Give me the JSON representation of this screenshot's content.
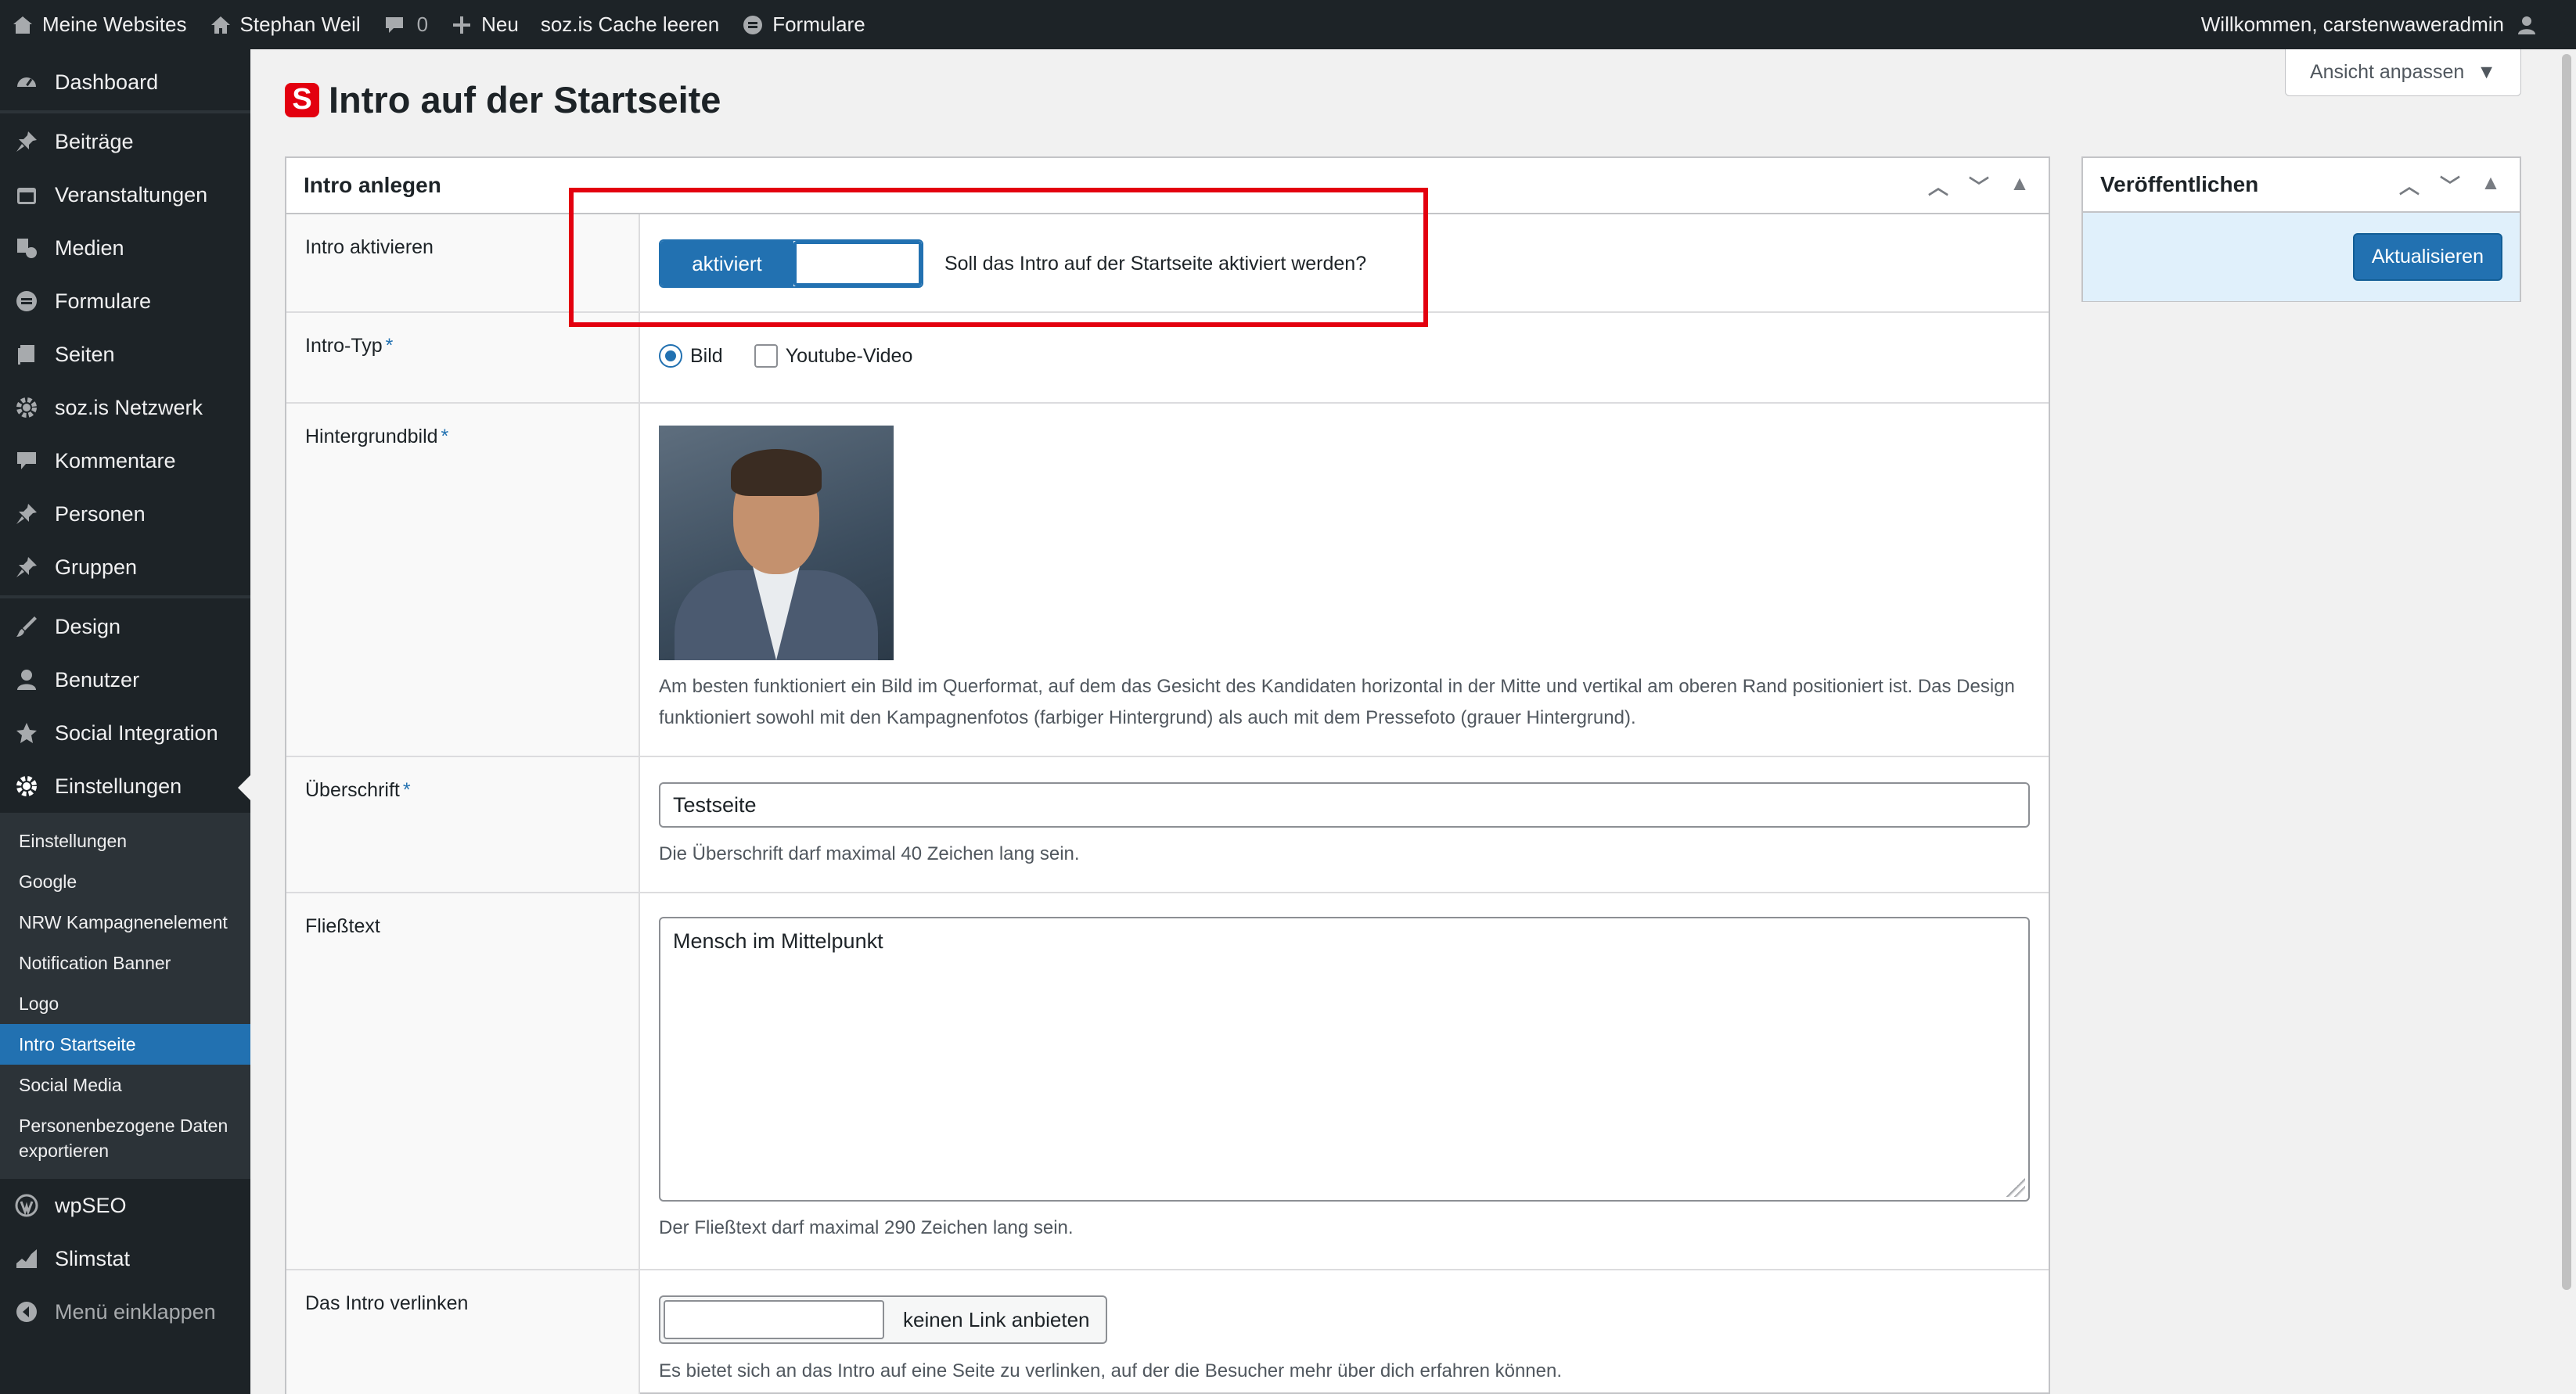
{
  "adminbar": {
    "my_sites": "Meine Websites",
    "site_name": "Stephan Weil",
    "comments_count": "0",
    "new_label": "Neu",
    "cache_label": "soz.is Cache leeren",
    "forms_label": "Formulare",
    "welcome": "Willkommen, carstenwaweradmin"
  },
  "sidebar": {
    "items": [
      {
        "label": "Dashboard",
        "icon": "dashboard-icon"
      },
      {
        "label": "Beiträge",
        "icon": "pin-icon"
      },
      {
        "label": "Veranstaltungen",
        "icon": "calendar-icon"
      },
      {
        "label": "Medien",
        "icon": "media-icon"
      },
      {
        "label": "Formulare",
        "icon": "forms-icon"
      },
      {
        "label": "Seiten",
        "icon": "pages-icon"
      },
      {
        "label": "soz.is Netzwerk",
        "icon": "gear-icon"
      },
      {
        "label": "Kommentare",
        "icon": "comment-icon"
      },
      {
        "label": "Personen",
        "icon": "pin-icon"
      },
      {
        "label": "Gruppen",
        "icon": "pin-icon"
      },
      {
        "label": "Design",
        "icon": "brush-icon"
      },
      {
        "label": "Benutzer",
        "icon": "user-icon"
      },
      {
        "label": "Social Integration",
        "icon": "star-icon"
      },
      {
        "label": "Einstellungen",
        "icon": "gear-icon"
      }
    ],
    "submenu": [
      "Einstellungen",
      "Google",
      "NRW Kampagnenelement",
      "Notification Banner",
      "Logo",
      "Intro Startseite",
      "Social Media",
      "Personenbezogene Daten exportieren"
    ],
    "bottom_items": [
      {
        "label": "wpSEO",
        "icon": "wordpress-icon"
      },
      {
        "label": "Slimstat",
        "icon": "stats-icon"
      }
    ],
    "collapse_label": "Menü einklappen"
  },
  "screen_options": {
    "label": "Ansicht anpassen"
  },
  "page": {
    "logo_letter": "S",
    "title": "Intro auf der Startseite"
  },
  "intro_box": {
    "title": "Intro anlegen",
    "fields": {
      "activate": {
        "label": "Intro aktivieren",
        "toggle_on": "aktiviert",
        "question": "Soll das Intro auf der Startseite aktiviert werden?"
      },
      "type": {
        "label": "Intro-Typ",
        "option_image": "Bild",
        "option_video": "Youtube-Video",
        "selected": "Bild"
      },
      "background": {
        "label": "Hintergrundbild",
        "description": "Am besten funktioniert ein Bild im Querformat, auf dem das Gesicht des Kandidaten horizontal in der Mitte und vertikal am oberen Rand positioniert ist. Das Design funktioniert sowohl mit den Kampagnenfotos (farbiger Hintergrund) als auch mit dem Pressefoto (grauer Hintergrund)."
      },
      "heading": {
        "label": "Überschrift",
        "value": "Testseite",
        "description": "Die Überschrift darf maximal 40 Zeichen lang sein."
      },
      "body": {
        "label": "Fließtext",
        "value": "Mensch im Mittelpunkt",
        "description": "Der Fließtext darf maximal 290 Zeichen lang sein."
      },
      "link": {
        "label": "Das Intro verlinken",
        "value": "",
        "button": "keinen Link anbieten",
        "description": "Es bietet sich an das Intro auf eine Seite zu verlinken, auf der die Besucher mehr über dich erfahren können."
      }
    }
  },
  "publish_box": {
    "title": "Veröffentlichen",
    "button": "Aktualisieren"
  },
  "colors": {
    "accent": "#2271b1",
    "highlight": "#e3000f",
    "adminbar": "#1d2327"
  }
}
